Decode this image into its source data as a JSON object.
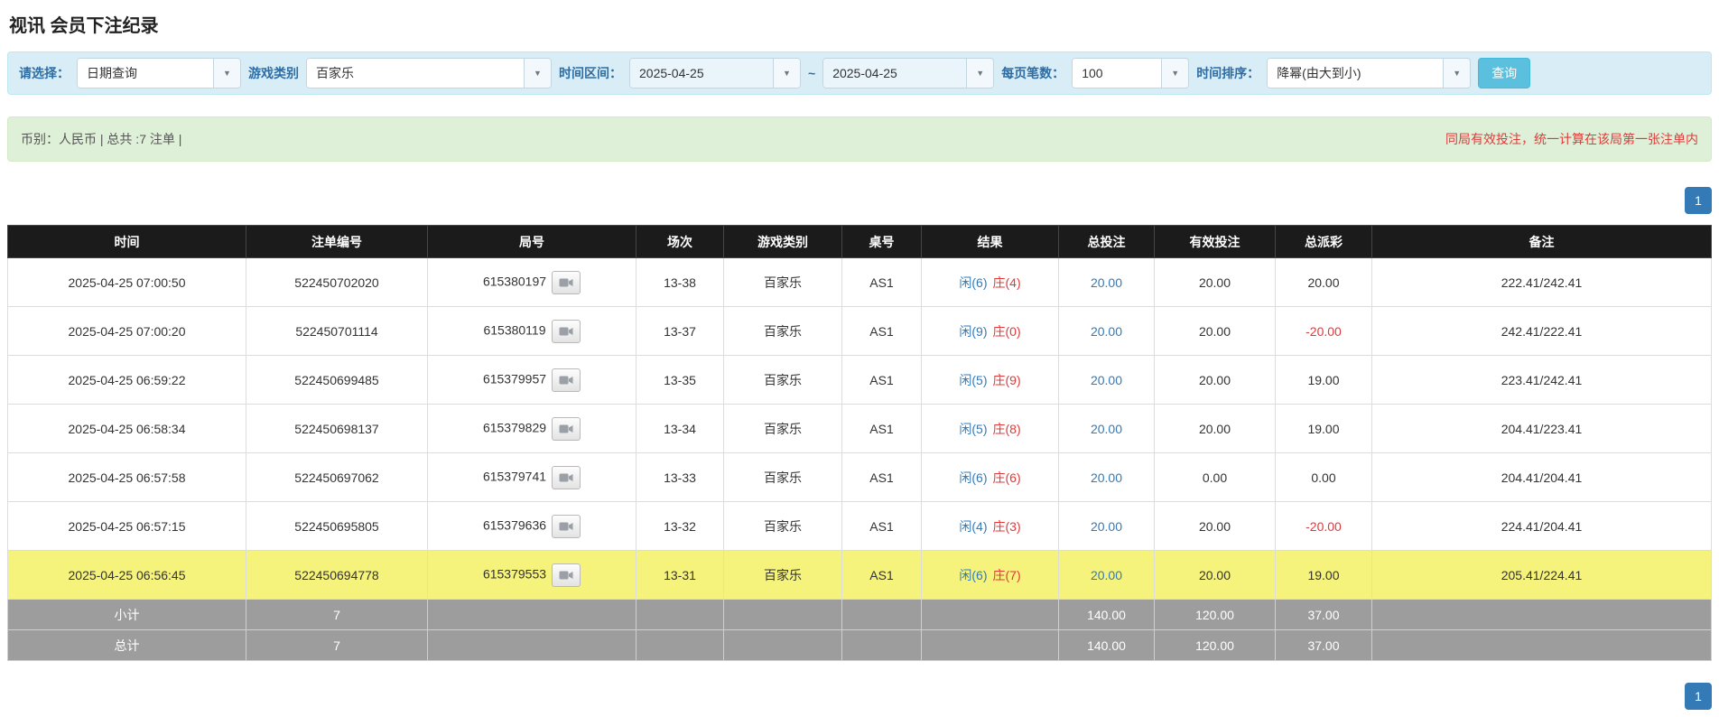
{
  "page": {
    "title": "视讯 会员下注纪录"
  },
  "icons": {
    "dropdown_caret": "▼"
  },
  "filters": {
    "select_label": "请选择：",
    "select_value": "日期查询",
    "game_type_label": "游戏类别",
    "game_type_value": "百家乐",
    "time_range_label": "时间区间：",
    "date_from": "2025-04-25",
    "range_separator": "~",
    "date_to": "2025-04-25",
    "page_size_label": "每页笔数：",
    "page_size_value": "100",
    "sort_label": "时间排序：",
    "sort_value": "降幂(由大到小)",
    "search_button": "查询"
  },
  "summary": {
    "left_text": "币别：人民币 | 总共 :7 注单 |",
    "right_text": "同局有效投注，统一计算在该局第一张注单内"
  },
  "pagination": {
    "page": "1"
  },
  "table": {
    "headers": [
      "时间",
      "注单编号",
      "局号",
      "场次",
      "游戏类别",
      "桌号",
      "结果",
      "总投注",
      "有效投注",
      "总派彩",
      "备注"
    ],
    "rows": [
      {
        "time": "2025-04-25 07:00:50",
        "bet_id": "522450702020",
        "round_id": "615380197",
        "session": "13-38",
        "game": "百家乐",
        "table_no": "AS1",
        "result_player": "闲(6)",
        "result_banker": "庄(4)",
        "total_bet": "20.00",
        "valid_bet": "20.00",
        "payout": "20.00",
        "payout_negative": false,
        "remark": "222.41/242.41",
        "highlighted": false
      },
      {
        "time": "2025-04-25 07:00:20",
        "bet_id": "522450701114",
        "round_id": "615380119",
        "session": "13-37",
        "game": "百家乐",
        "table_no": "AS1",
        "result_player": "闲(9)",
        "result_banker": "庄(0)",
        "total_bet": "20.00",
        "valid_bet": "20.00",
        "payout": "-20.00",
        "payout_negative": true,
        "remark": "242.41/222.41",
        "highlighted": false
      },
      {
        "time": "2025-04-25 06:59:22",
        "bet_id": "522450699485",
        "round_id": "615379957",
        "session": "13-35",
        "game": "百家乐",
        "table_no": "AS1",
        "result_player": "闲(5)",
        "result_banker": "庄(9)",
        "total_bet": "20.00",
        "valid_bet": "20.00",
        "payout": "19.00",
        "payout_negative": false,
        "remark": "223.41/242.41",
        "highlighted": false
      },
      {
        "time": "2025-04-25 06:58:34",
        "bet_id": "522450698137",
        "round_id": "615379829",
        "session": "13-34",
        "game": "百家乐",
        "table_no": "AS1",
        "result_player": "闲(5)",
        "result_banker": "庄(8)",
        "total_bet": "20.00",
        "valid_bet": "20.00",
        "payout": "19.00",
        "payout_negative": false,
        "remark": "204.41/223.41",
        "highlighted": false
      },
      {
        "time": "2025-04-25 06:57:58",
        "bet_id": "522450697062",
        "round_id": "615379741",
        "session": "13-33",
        "game": "百家乐",
        "table_no": "AS1",
        "result_player": "闲(6)",
        "result_banker": "庄(6)",
        "total_bet": "20.00",
        "valid_bet": "0.00",
        "payout": "0.00",
        "payout_negative": false,
        "remark": "204.41/204.41",
        "highlighted": false
      },
      {
        "time": "2025-04-25 06:57:15",
        "bet_id": "522450695805",
        "round_id": "615379636",
        "session": "13-32",
        "game": "百家乐",
        "table_no": "AS1",
        "result_player": "闲(4)",
        "result_banker": "庄(3)",
        "total_bet": "20.00",
        "valid_bet": "20.00",
        "payout": "-20.00",
        "payout_negative": true,
        "remark": "224.41/204.41",
        "highlighted": false
      },
      {
        "time": "2025-04-25 06:56:45",
        "bet_id": "522450694778",
        "round_id": "615379553",
        "session": "13-31",
        "game": "百家乐",
        "table_no": "AS1",
        "result_player": "闲(6)",
        "result_banker": "庄(7)",
        "total_bet": "20.00",
        "valid_bet": "20.00",
        "payout": "19.00",
        "payout_negative": false,
        "remark": "205.41/224.41",
        "highlighted": true
      }
    ],
    "subtotal": {
      "label": "小计",
      "count": "7",
      "total_bet": "140.00",
      "valid_bet": "120.00",
      "payout": "37.00"
    },
    "total": {
      "label": "总计",
      "count": "7",
      "total_bet": "140.00",
      "valid_bet": "120.00",
      "payout": "37.00"
    }
  },
  "colors": {
    "accent_blue": "#337ab7",
    "label_blue": "#2e6da4",
    "filter_bg": "#d9edf7",
    "filter_border": "#bce8f1",
    "summary_bg": "#dff0d8",
    "summary_border": "#d6e9c6",
    "warning_red": "#e03a3a",
    "negative_red": "#e03a3a",
    "player_blue": "#337ab7",
    "banker_red": "#e03a3a",
    "header_bg": "#1b1b1b",
    "highlight_yellow": "#f5f37b",
    "footer_gray": "#9d9d9d",
    "search_button_bg": "#5bc0de",
    "search_button_border": "#46b8da"
  }
}
